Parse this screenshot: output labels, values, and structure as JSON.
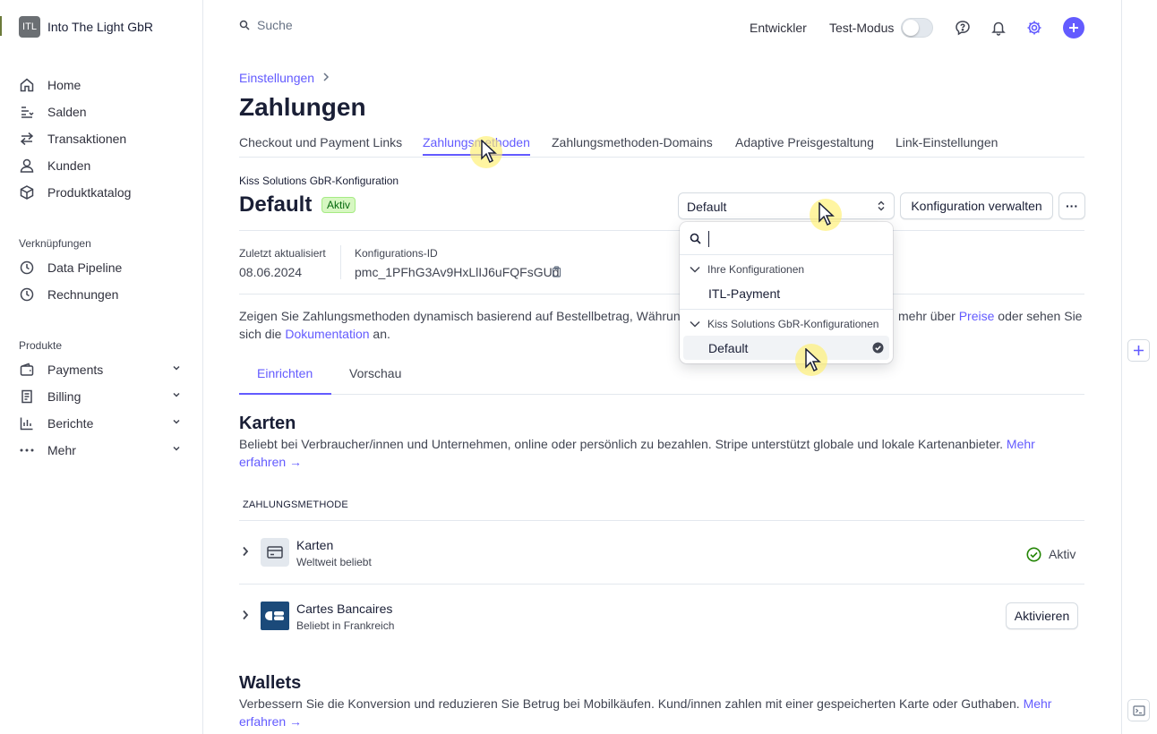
{
  "account": {
    "logo_text": "ITL",
    "name": "Into The Light GbR"
  },
  "nav": {
    "main": [
      {
        "label": "Home",
        "icon": "home-icon"
      },
      {
        "label": "Salden",
        "icon": "balance-icon"
      },
      {
        "label": "Transaktionen",
        "icon": "transactions-icon"
      },
      {
        "label": "Kunden",
        "icon": "customer-icon"
      },
      {
        "label": "Produktkatalog",
        "icon": "box-icon"
      }
    ],
    "shortcuts_heading": "Verknüpfungen",
    "shortcuts": [
      {
        "label": "Data Pipeline",
        "icon": "clock-icon"
      },
      {
        "label": "Rechnungen",
        "icon": "clock-icon"
      }
    ],
    "products_heading": "Produkte",
    "products": [
      {
        "label": "Payments",
        "icon": "wallet-icon"
      },
      {
        "label": "Billing",
        "icon": "billing-icon"
      },
      {
        "label": "Berichte",
        "icon": "chart-icon"
      },
      {
        "label": "Mehr",
        "icon": "dots-icon"
      }
    ]
  },
  "topbar": {
    "search_placeholder": "Suche",
    "developer": "Entwickler",
    "test_mode": "Test-Modus",
    "test_mode_on": false
  },
  "breadcrumb": "Einstellungen",
  "page_title": "Zahlungen",
  "tabs": [
    "Checkout und Payment Links",
    "Zahlungsmethoden",
    "Zahlungsmethoden-Domains",
    "Adaptive Preisgestaltung",
    "Link-Einstellungen"
  ],
  "active_tab": "Zahlungsmethoden",
  "config": {
    "owner_label": "Kiss Solutions GbR-Konfiguration",
    "name": "Default",
    "status": "Aktiv",
    "select_value": "Default",
    "manage_button": "Konfiguration verwalten",
    "more_button": "···",
    "updated_label": "Zuletzt aktualisiert",
    "updated_value": "08.06.2024",
    "id_label": "Konfigurations-ID",
    "id_value": "pmc_1PFhG3Av9HxLlIJ6uFQFsGUd"
  },
  "description": {
    "part1": "Zeigen Sie Zahlungsmethoden dynamisch basierend auf Bestellbetrag, Währung",
    "part2": "mehr über",
    "link_prices": "Preise",
    "part3": "oder sehen Sie",
    "part4": "sich die",
    "link_docs": "Dokumentation",
    "part5": "an."
  },
  "subtabs": [
    "Einrichten",
    "Vorschau"
  ],
  "cards_section": {
    "heading": "Karten",
    "text": "Beliebt bei Verbraucher/innen und Unternehmen, online oder persönlich zu bezahlen. Stripe unterstützt globale und lokale Kartenanbieter.",
    "link": "Mehr erfahren →",
    "column_header": "ZAHLUNGSMETHODE",
    "methods": [
      {
        "name": "Karten",
        "sub": "Weltweit beliebt",
        "status": "Aktiv"
      },
      {
        "name": "Cartes Bancaires",
        "sub": "Beliebt in Frankreich",
        "action": "Aktivieren"
      }
    ]
  },
  "wallets_section": {
    "heading": "Wallets",
    "text": "Verbessern Sie die Konversion und reduzieren Sie Betrug bei Mobilkäufen. Kund/innen zahlen mit einer gespeicherten Karte oder Guthaben.",
    "link": "Mehr erfahren →"
  },
  "dropdown": {
    "search_value": "",
    "groups": [
      {
        "label": "Ihre Konfigurationen",
        "items": [
          "ITL-Payment"
        ]
      },
      {
        "label": "Kiss Solutions GbR-Konfigurationen",
        "items": [
          "Default"
        ]
      }
    ],
    "selected": "Default"
  },
  "colors": {
    "accent": "#635bff",
    "active_badge_bg": "#d7f7c2",
    "active_badge_text": "#05690d",
    "status_green": "#228403"
  }
}
